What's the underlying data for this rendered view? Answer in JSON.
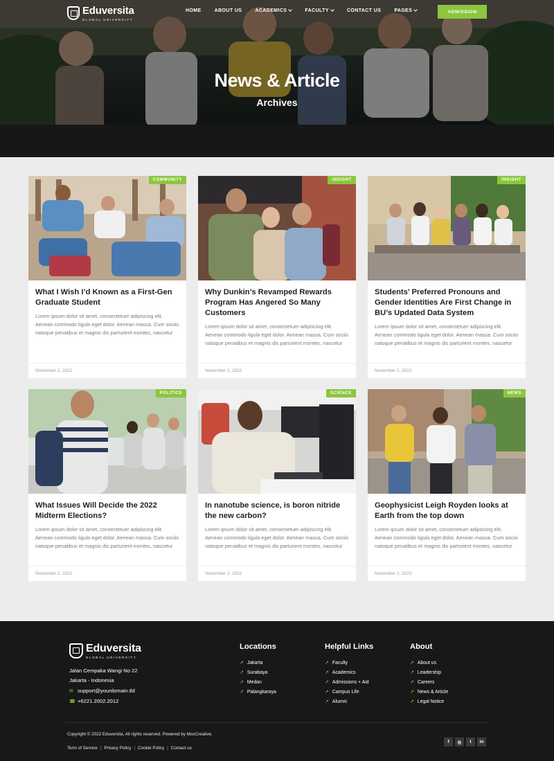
{
  "header": {
    "brand": "Eduversita",
    "brand_tagline": "GLOBAL UNIVERSITY",
    "nav": [
      {
        "label": "HOME",
        "dropdown": false
      },
      {
        "label": "ABOUT US",
        "dropdown": false
      },
      {
        "label": "ACADEMICS",
        "dropdown": true
      },
      {
        "label": "FACULTY",
        "dropdown": true
      },
      {
        "label": "CONTACT US",
        "dropdown": false
      },
      {
        "label": "PAGES",
        "dropdown": true
      }
    ],
    "cta_label": "ADMISSION"
  },
  "hero": {
    "title": "News & Article",
    "subtitle": "Archives"
  },
  "posts": [
    {
      "category": "COMMUNITY",
      "title": "What I Wish I’d Known as a First-Gen Graduate Student",
      "excerpt": "Lorem ipsum dolor sit amet, consectetuer adipiscing elit. Aenean commodo ligula eget dolor. Aenean massa. Cum sociis natoque penatibus et magnis dis parturient montes, nascetur",
      "date": "November 2, 2022"
    },
    {
      "category": "INSIGHT",
      "title": "Why Dunkin’s Revamped Rewards Program Has Angered So Many Customers",
      "excerpt": "Lorem ipsum dolor sit amet, consectetuer adipiscing elit. Aenean commodo ligula eget dolor. Aenean massa. Cum sociis natoque penatibus et magnis dis parturient montes, nascetur",
      "date": "November 2, 2022"
    },
    {
      "category": "INSIGHT",
      "title": "Students’ Preferred Pronouns and Gender Identities Are First Change in BU’s Updated Data System",
      "excerpt": "Lorem ipsum dolor sit amet, consectetuer adipiscing elit. Aenean commodo ligula eget dolor. Aenean massa. Cum sociis natoque penatibus et magnis dis parturient montes, nascetur",
      "date": "November 2, 2022"
    },
    {
      "category": "POLITICS",
      "title": "What Issues Will Decide the 2022 Midterm Elections?",
      "excerpt": "Lorem ipsum dolor sit amet, consectetuer adipiscing elit. Aenean commodo ligula eget dolor. Aenean massa. Cum sociis natoque penatibus et magnis dis parturient montes, nascetur",
      "date": "November 2, 2022"
    },
    {
      "category": "SCIENCE",
      "title": "In nanotube science, is boron nitride the new carbon?",
      "excerpt": "Lorem ipsum dolor sit amet, consectetuer adipiscing elit. Aenean commodo ligula eget dolor. Aenean massa. Cum sociis natoque penatibus et magnis dis parturient montes, nascetur",
      "date": "November 2, 2022"
    },
    {
      "category": "NEWS",
      "title": "Geophysicist Leigh Royden looks at Earth from the top down",
      "excerpt": "Lorem ipsum dolor sit amet, consectetuer adipiscing elit. Aenean commodo ligula eget dolor. Aenean massa. Cum sociis natoque penatibus et magnis dis parturient montes, nascetur",
      "date": "November 2, 2022"
    }
  ],
  "footer": {
    "brand": "Eduversita",
    "brand_tagline": "GLOBAL UNIVERSITY",
    "address_line1": "Jalan Cempaka Wangi No 22",
    "address_line2": "Jakarta - Indonesia",
    "email": "support@yourdomain.tld",
    "phone": "+6221.2002.2012",
    "columns": [
      {
        "heading": "Locations",
        "links": [
          "Jakarta",
          "Surabaya",
          "Medan",
          "Palangkaraya"
        ]
      },
      {
        "heading": "Helpful Links",
        "links": [
          "Faculty",
          "Academics",
          "Admissions + Aid",
          "Campus Life",
          "Alumni"
        ]
      },
      {
        "heading": "About",
        "links": [
          "About us",
          "Leadership",
          "Careers",
          "News & Article",
          "Legal Notice"
        ]
      }
    ],
    "copyright": "Copyright © 2022 Eduversita, All rights reserved. Powered by MoxCreative.",
    "legal_links": [
      "Term of Service",
      "Privacy Policy",
      "Cookie Policy",
      "Contact us"
    ],
    "social": [
      {
        "icon": "facebook-icon",
        "glyph": "f"
      },
      {
        "icon": "instagram-icon",
        "glyph": "◎"
      },
      {
        "icon": "twitter-icon",
        "glyph": "t"
      },
      {
        "icon": "linkedin-icon",
        "glyph": "in"
      }
    ]
  },
  "colors": {
    "accent": "#8cc63f",
    "footer_bg": "#181818",
    "page_bg": "#ececec"
  }
}
